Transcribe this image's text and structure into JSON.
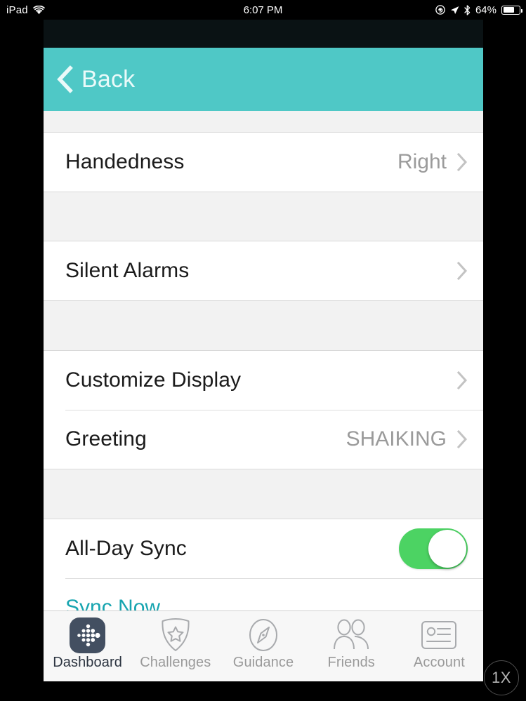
{
  "status_bar": {
    "device_label": "iPad",
    "wifi_icon": "wifi-icon",
    "time": "6:07 PM",
    "rotation_lock_icon": "rotation-lock-icon",
    "location_icon": "location-arrow-icon",
    "bluetooth_icon": "bluetooth-icon",
    "battery_percent": "64%",
    "battery_icon": "battery-icon"
  },
  "navbar": {
    "back_label": "Back",
    "back_icon": "chevron-left-icon",
    "background_color": "#4fc8c6"
  },
  "settings": {
    "groups": [
      {
        "rows": [
          {
            "title": "Handedness",
            "value": "Right",
            "accessory": "chevron-right-icon"
          }
        ]
      },
      {
        "rows": [
          {
            "title": "Silent Alarms",
            "value": "",
            "accessory": "chevron-right-icon"
          }
        ]
      },
      {
        "rows": [
          {
            "title": "Customize Display",
            "value": "",
            "accessory": "chevron-right-icon"
          },
          {
            "title": "Greeting",
            "value": "SHAIKING",
            "accessory": "chevron-right-icon"
          }
        ]
      },
      {
        "rows": [
          {
            "title": "All-Day Sync",
            "value": "",
            "accessory": "toggle-switch",
            "toggle_on": true
          }
        ],
        "link": {
          "label": "Sync Now",
          "color": "#18a5b0"
        }
      }
    ]
  },
  "tabbar": {
    "tabs": [
      {
        "label": "Dashboard",
        "icon": "fitbit-logo-icon",
        "active": true
      },
      {
        "label": "Challenges",
        "icon": "shield-star-icon",
        "active": false
      },
      {
        "label": "Guidance",
        "icon": "compass-icon",
        "active": false
      },
      {
        "label": "Friends",
        "icon": "two-people-icon",
        "active": false
      },
      {
        "label": "Account",
        "icon": "id-card-icon",
        "active": false
      }
    ]
  },
  "zoom_badge": {
    "label": "1X"
  }
}
